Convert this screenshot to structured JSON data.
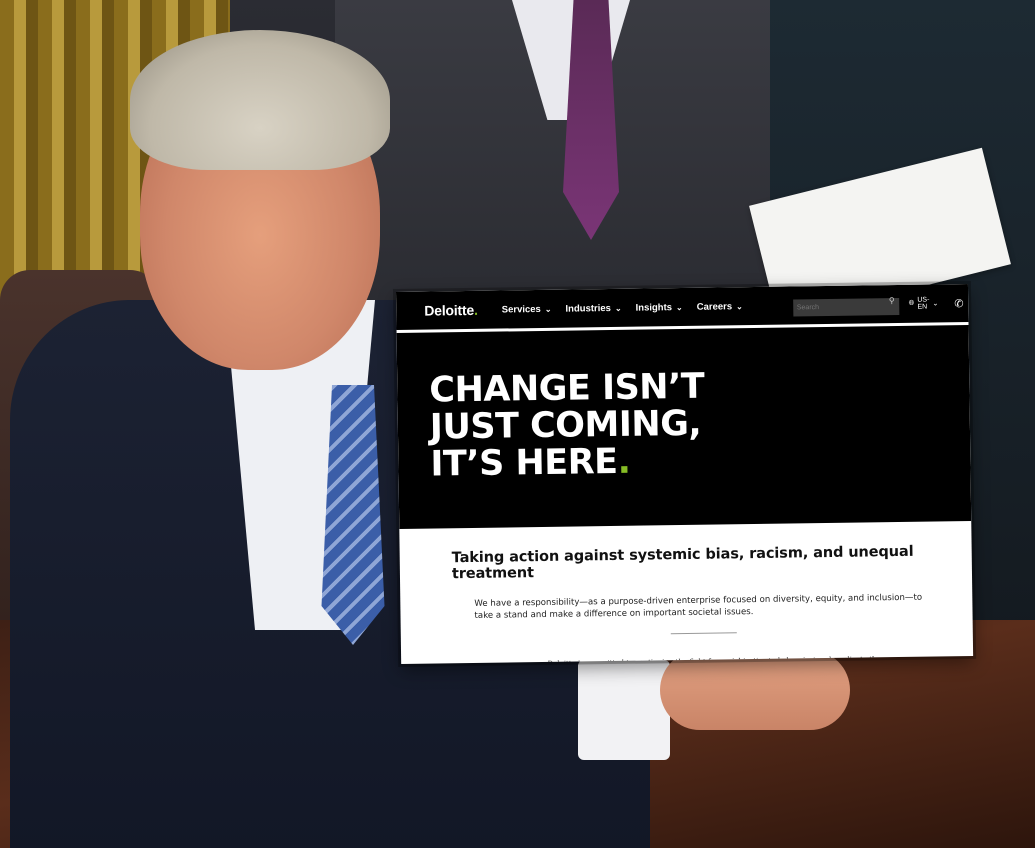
{
  "site": {
    "logo_text": "Deloitte",
    "logo_dot": ".",
    "brand_green": "#86bc25",
    "nav": [
      {
        "label": "Services"
      },
      {
        "label": "Industries"
      },
      {
        "label": "Insights"
      },
      {
        "label": "Careers"
      }
    ],
    "search_placeholder": "Search",
    "language": "US-EN",
    "icons": {
      "search": "search-icon",
      "globe": "globe-icon",
      "phone": "phone-icon",
      "profile": "user-icon"
    }
  },
  "hero": {
    "line1": "CHANGE ISN’T",
    "line2": "JUST COMING,",
    "line3": "IT’S HERE",
    "line3_dot": "."
  },
  "section": {
    "heading": "Taking action against systemic bias, racism, and unequal treatment",
    "body": "We have a responsibility—as a purpose-driven enterprise focused on diversity, equity, and inclusion—to take a stand and make a difference on important societal issues.",
    "quote": "Deloitte is committed to continuing the fight for social justice to help reject and eradicate the"
  }
}
